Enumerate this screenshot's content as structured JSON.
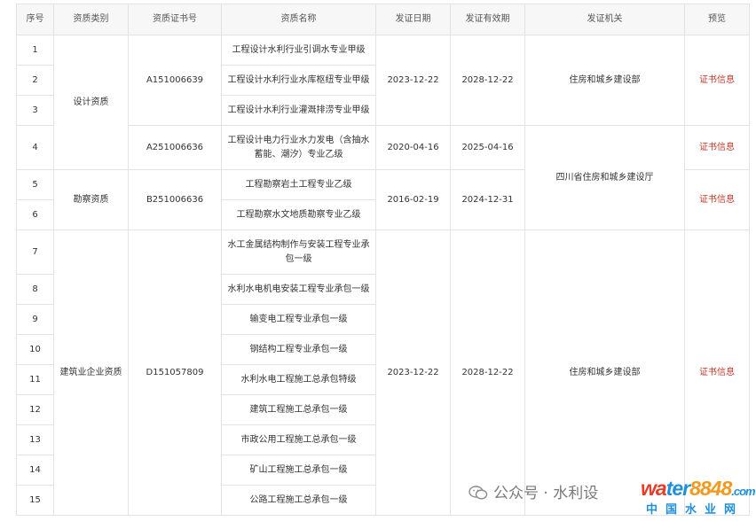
{
  "headers": [
    "序号",
    "资质类别",
    "资质证书号",
    "资质名称",
    "发证日期",
    "发证有效期",
    "发证机关",
    "预览"
  ],
  "link_label": "证书信息",
  "numbers": [
    "1",
    "2",
    "3",
    "4",
    "5",
    "6",
    "7",
    "8",
    "9",
    "10",
    "11",
    "12",
    "13",
    "14",
    "15"
  ],
  "categories": [
    "设计资质",
    "勘察资质",
    "建筑业企业资质"
  ],
  "cert_numbers": [
    "A151006639",
    "A251006636",
    "B251006636",
    "D151057809"
  ],
  "names": [
    "工程设计水利行业引调水专业甲级",
    "工程设计水利行业水库枢纽专业甲级",
    "工程设计水利行业灌溉排涝专业甲级",
    "工程设计电力行业水力发电（含抽水蓄能、潮汐）专业乙级",
    "工程勘察岩土工程专业乙级",
    "工程勘察水文地质勘察专业乙级",
    "水工金属结构制作与安装工程专业承包一级",
    "水利水电机电安装工程专业承包一级",
    "输变电工程专业承包一级",
    "钢结构工程专业承包一级",
    "水利水电工程施工总承包特级",
    "建筑工程施工总承包一级",
    "市政公用工程施工总承包一级",
    "矿山工程施工总承包一级",
    "公路工程施工总承包一级"
  ],
  "issue_dates": [
    "2023-12-22",
    "2020-04-16",
    "2016-02-19",
    "2023-12-22"
  ],
  "valid_dates": [
    "2028-12-22",
    "2025-04-16",
    "2024-12-31",
    "2028-12-22"
  ],
  "authorities": [
    "住房和城乡建设部",
    "四川省住房和城乡建设厅",
    "住房和城乡建设部"
  ],
  "watermark": {
    "text": "公众号 · 水利设",
    "logo_a": "wa",
    "logo_b": "ter",
    "logo_c": "8848",
    "logo_suffix": ".com",
    "sub": "中国水业网"
  },
  "colors": {
    "link": "#c0392b",
    "header_bg": "#f7f7f7",
    "border": "#e3e3e3"
  }
}
